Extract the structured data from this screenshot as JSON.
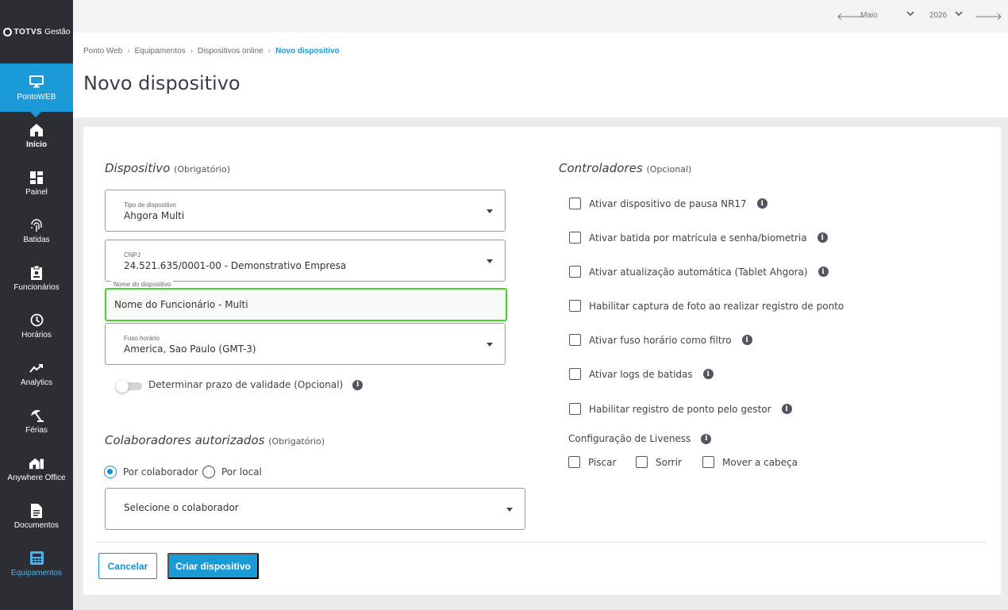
{
  "brand": {
    "name_bold": "TOTVS",
    "name_light": "Gestão"
  },
  "sidebar": {
    "active": {
      "label": "PontoWEB",
      "icon": "monitor-icon"
    },
    "items": [
      {
        "label": "Início",
        "icon": "home-icon"
      },
      {
        "label": "Painel",
        "icon": "dashboard-icon"
      },
      {
        "label": "Batidas",
        "icon": "fingerprint-icon"
      },
      {
        "label": "Funcionários",
        "icon": "badge-icon"
      },
      {
        "label": "Horários",
        "icon": "clock-icon"
      },
      {
        "label": "Analytics",
        "icon": "trend-icon"
      },
      {
        "label": "Férias",
        "icon": "beach-umbrella-icon"
      },
      {
        "label": "Anywhere Office",
        "icon": "home-office-icon"
      },
      {
        "label": "Documentos",
        "icon": "document-icon"
      },
      {
        "label": "Equipamentos",
        "icon": "device-icon"
      }
    ]
  },
  "topbar": {
    "month": "Maio",
    "year": "2026"
  },
  "breadcrumb": [
    "Ponto Web",
    "Equipamentos",
    "Dispositivos online",
    "Novo dispositivo"
  ],
  "page_title": "Novo dispositivo",
  "dispositivo": {
    "title": "Dispositivo",
    "hint": "(Obrigatório)",
    "tipo": {
      "label": "Tipo de dispositivo",
      "value": "Ahgora Multi"
    },
    "cnpj": {
      "label": "CNPJ",
      "value": "24.521.635/0001-00 - Demonstrativo Empresa"
    },
    "nome": {
      "label": "Nome do dispositivo",
      "value": "Nome do Funcionário - Multi"
    },
    "fuso": {
      "label": "Fuso horário",
      "value": "America, Sao Paulo (GMT-3)"
    },
    "validade_label": "Determinar prazo de validade (Opcional)"
  },
  "colaboradores": {
    "title": "Colaboradores autorizados",
    "hint": "(Obrigatório)",
    "radio_colaborador": "Por colaborador",
    "radio_local": "Por local",
    "select_placeholder": "Selecione o colaborador"
  },
  "controladores": {
    "title": "Controladores",
    "hint": "(Opcional)",
    "options": [
      "Ativar dispositivo de pausa NR17",
      "Ativar batida por matrícula e senha/biometria",
      "Ativar atualização automática (Tablet Ahgora)",
      "Habilitar captura de foto ao realizar registro de ponto",
      "Ativar fuso horário como filtro",
      "Ativar logs de batidas",
      "Habilitar registro de ponto pelo gestor"
    ],
    "liveness_title": "Configuração de Liveness",
    "liveness": [
      "Piscar",
      "Sorrir",
      "Mover a cabeça"
    ]
  },
  "actions": {
    "cancel": "Cancelar",
    "create": "Criar dispositivo"
  },
  "colors": {
    "accent": "#1a9ad6",
    "sidebar": "#2c2e33",
    "focus": "#4ad12a"
  }
}
